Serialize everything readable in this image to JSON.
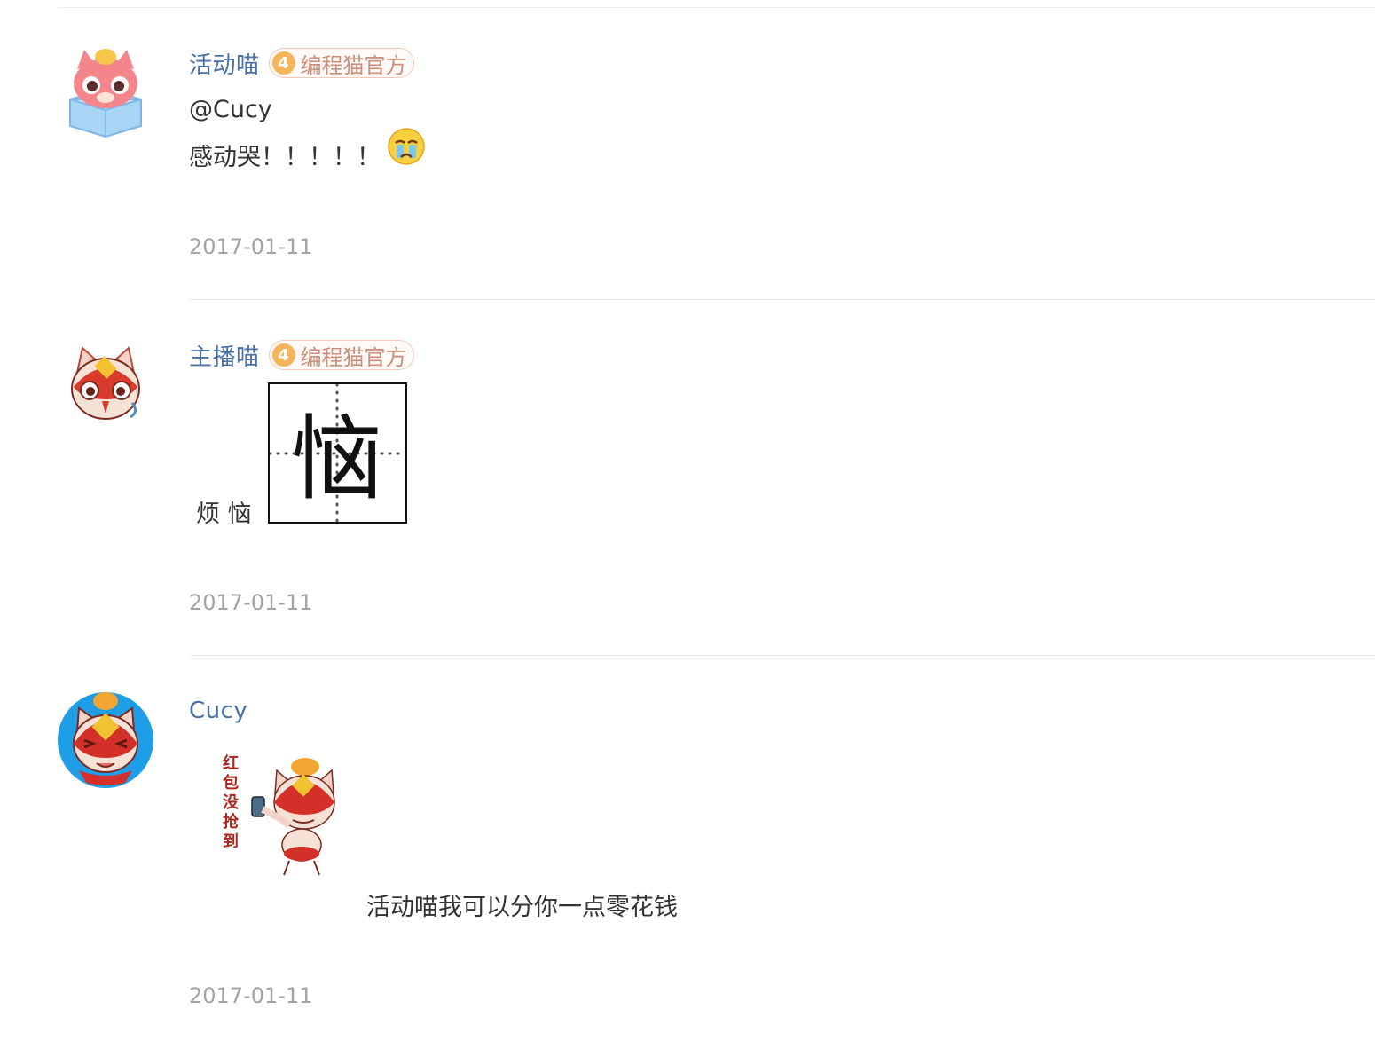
{
  "comments": [
    {
      "username": "活动喵",
      "badge": {
        "level": "4",
        "label": "编程猫官方"
      },
      "lines": [
        "@Cucy",
        "感动哭！！！！！"
      ],
      "emoji": "crying-face",
      "date": "2017-01-11"
    },
    {
      "username": "主播喵",
      "badge": {
        "level": "4",
        "label": "编程猫官方"
      },
      "text": "烦 恼",
      "image_char": "恼",
      "date": "2017-01-11"
    },
    {
      "username": "Cucy",
      "sticker_text": "红包没抢到",
      "text": "活动喵我可以分你一点零花钱",
      "date": "2017-01-11"
    }
  ],
  "colors": {
    "username": "#4a70a6",
    "badge_border": "#f3c9b5",
    "badge_level": "#f6b55a",
    "date": "#a3a3a3"
  }
}
